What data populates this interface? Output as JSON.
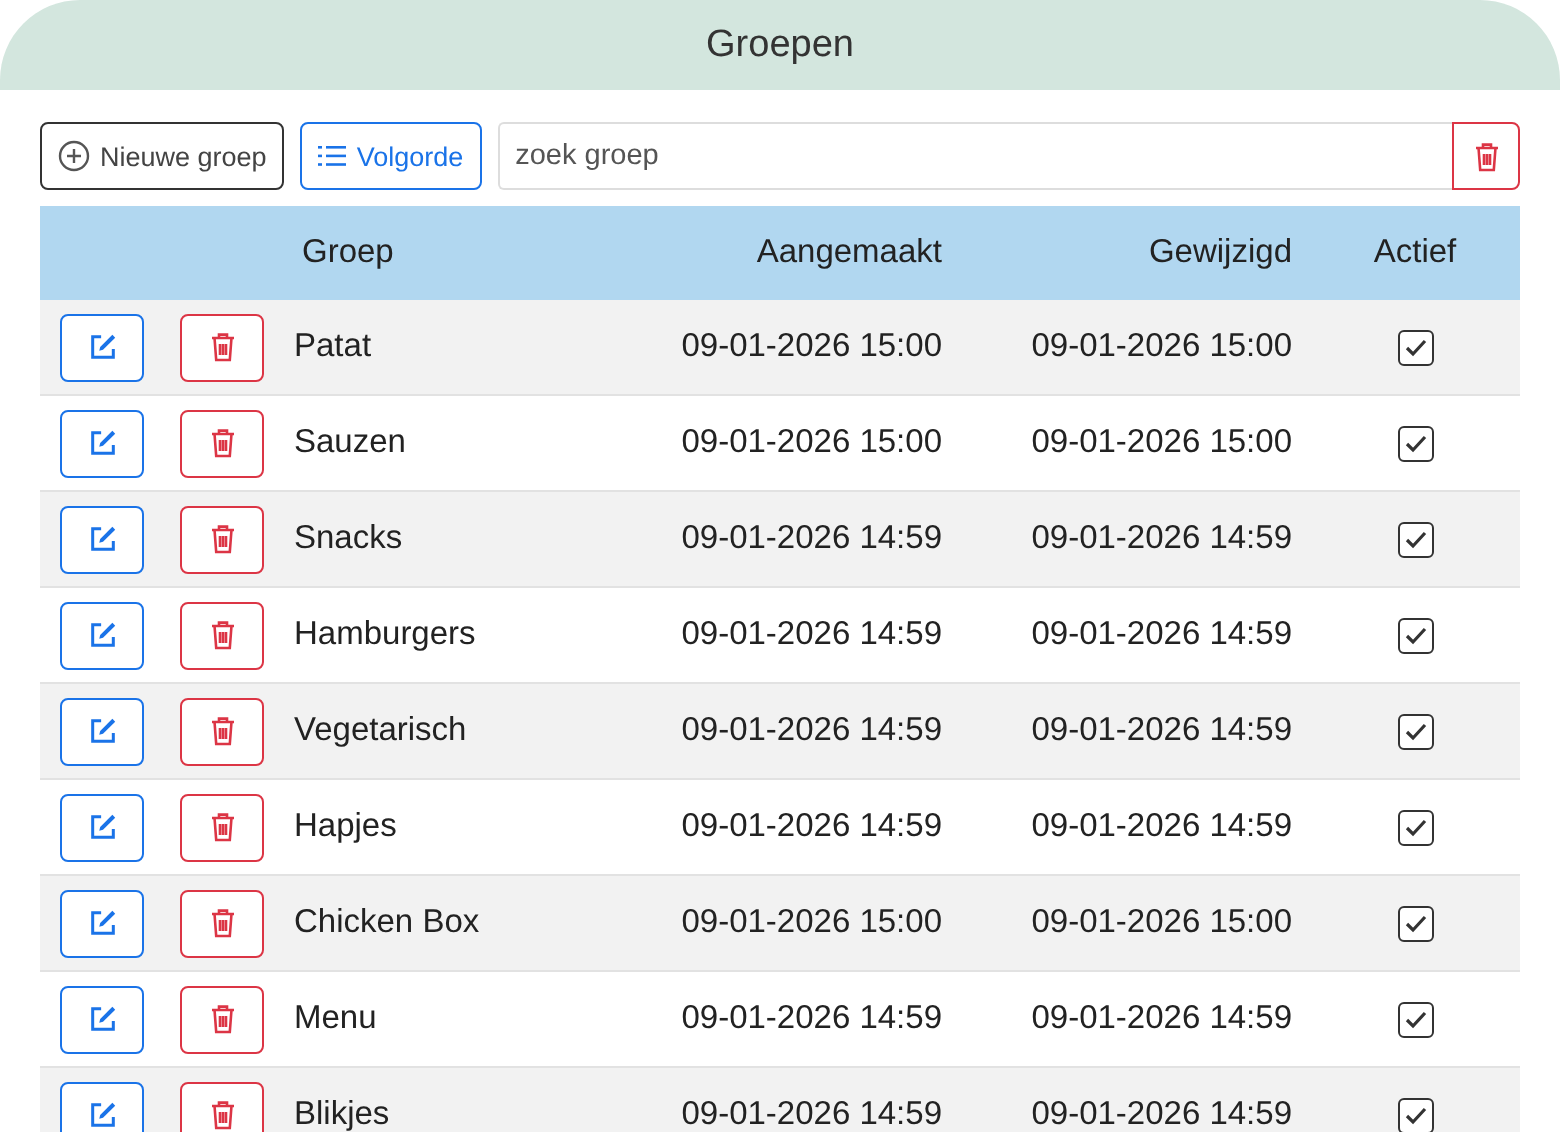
{
  "title": "Groepen",
  "toolbar": {
    "new_button": "Nieuwe groep",
    "order_button": "Volgorde",
    "search": {
      "placeholder": "zoek groep"
    }
  },
  "table": {
    "columns": [
      "Groep",
      "Aangemaakt",
      "Gewijzigd",
      "Actief"
    ],
    "rows": [
      {
        "name": "Patat",
        "created": "09-01-2026 15:00",
        "modified": "09-01-2026 15:00",
        "active": true
      },
      {
        "name": "Sauzen",
        "created": "09-01-2026 15:00",
        "modified": "09-01-2026 15:00",
        "active": true
      },
      {
        "name": "Snacks",
        "created": "09-01-2026 14:59",
        "modified": "09-01-2026 14:59",
        "active": true
      },
      {
        "name": "Hamburgers",
        "created": "09-01-2026 14:59",
        "modified": "09-01-2026 14:59",
        "active": true
      },
      {
        "name": "Vegetarisch",
        "created": "09-01-2026 14:59",
        "modified": "09-01-2026 14:59",
        "active": true
      },
      {
        "name": "Hapjes",
        "created": "09-01-2026 14:59",
        "modified": "09-01-2026 14:59",
        "active": true
      },
      {
        "name": "Chicken Box",
        "created": "09-01-2026 15:00",
        "modified": "09-01-2026 15:00",
        "active": true
      },
      {
        "name": "Menu",
        "created": "09-01-2026 14:59",
        "modified": "09-01-2026 14:59",
        "active": true
      },
      {
        "name": "Blikjes",
        "created": "09-01-2026 14:59",
        "modified": "09-01-2026 14:59",
        "active": true
      }
    ]
  }
}
